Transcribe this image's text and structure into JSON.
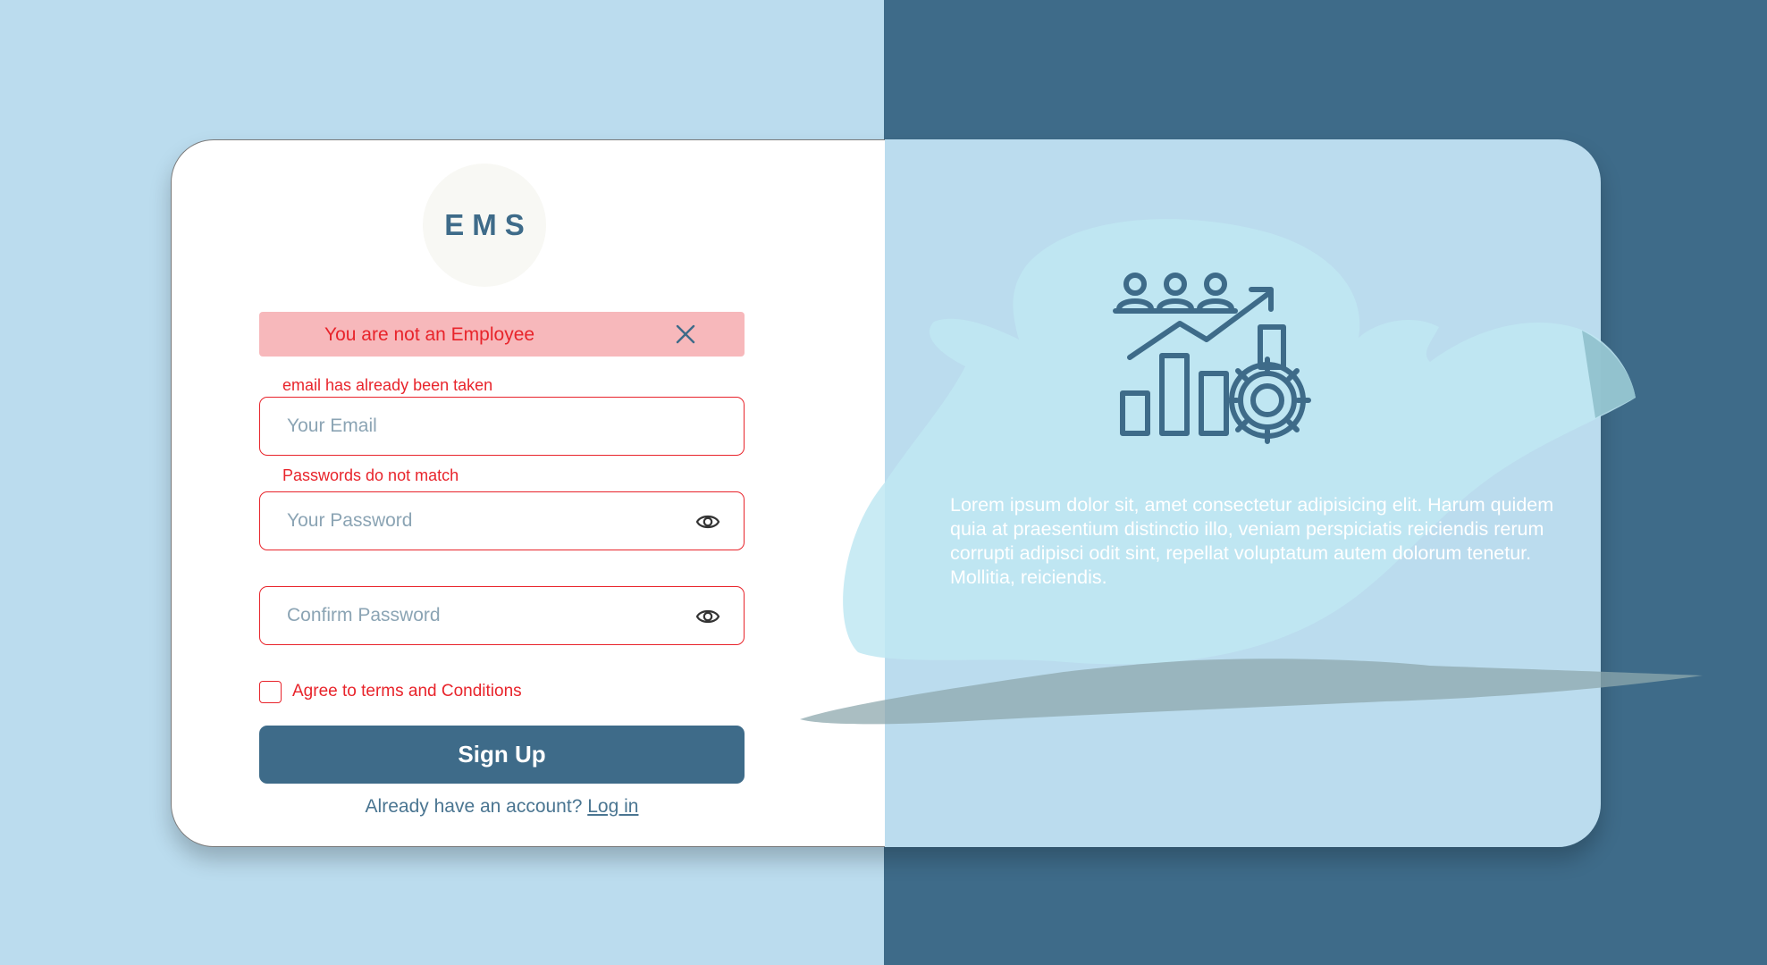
{
  "app": {
    "logo_text": "EMS"
  },
  "alert": {
    "message": "You are not an Employee",
    "close_icon": "close-icon",
    "background": "#f7b8bb",
    "text_color": "#e8242b"
  },
  "form": {
    "email": {
      "error": "email has already been taken",
      "placeholder": "Your Email",
      "value": ""
    },
    "password": {
      "error": "Passwords do not match",
      "placeholder": "Your Password",
      "value": "",
      "toggle_icon": "eye-icon"
    },
    "confirm_password": {
      "placeholder": "Confirm Password",
      "value": "",
      "toggle_icon": "eye-icon"
    },
    "terms": {
      "label": "Agree to terms and Conditions",
      "checked": false
    },
    "submit_label": "Sign Up",
    "login_prompt": "Already have an account?",
    "login_link": "Log in"
  },
  "info_panel": {
    "illustration_icon": "team-growth-chart-gear-icon",
    "text": "Lorem ipsum dolor sit, amet consectetur adipisicing elit. Harum quidem quia at praesentium distinctio illo, veniam perspiciatis reiciendis rerum corrupti adipisci odit sint, repellat voluptatum autem dolorum tenetur. Mollitia, reiciendis."
  },
  "colors": {
    "background_light": "#bbdcee",
    "background_dark": "#3e6b89",
    "accent": "#3e6b89",
    "error": "#e8242b",
    "card": "#ffffff"
  }
}
